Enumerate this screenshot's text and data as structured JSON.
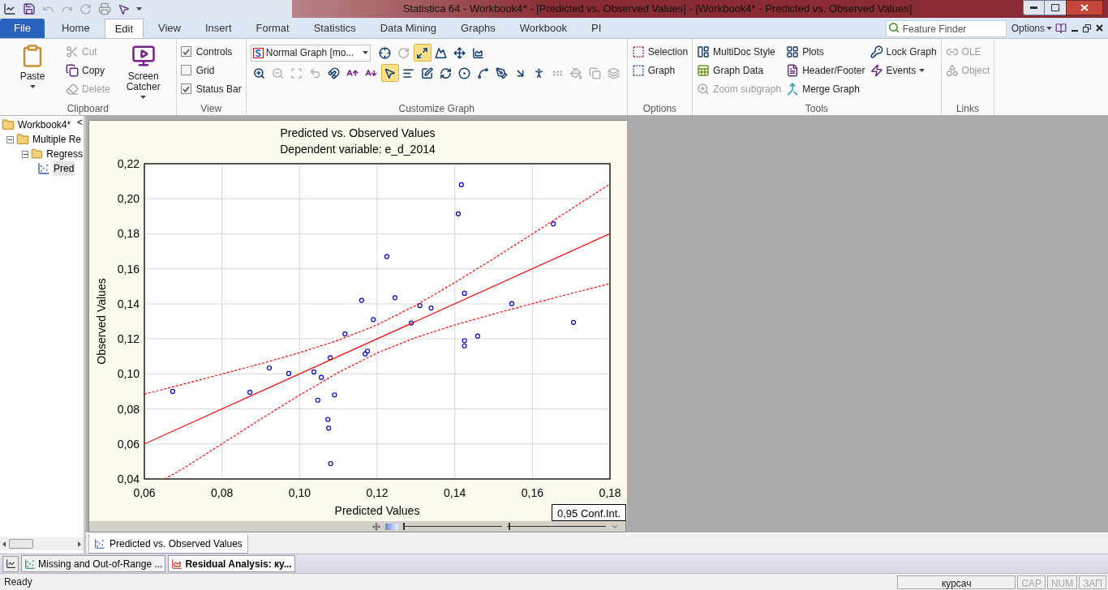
{
  "window": {
    "title": "Statistica 64 - Workbook4* - [Predicted vs. Observed Values] - [Workbook4* - Predicted vs. Observed Values]"
  },
  "ribbon_tabs": [
    {
      "label": "File",
      "kind": "file",
      "selected": false
    },
    {
      "label": "Home",
      "kind": "tab",
      "selected": false
    },
    {
      "label": "Edit",
      "kind": "tab",
      "selected": true
    },
    {
      "label": "View",
      "kind": "tab",
      "selected": false
    },
    {
      "label": "Insert",
      "kind": "tab",
      "selected": false
    },
    {
      "label": "Format",
      "kind": "tab",
      "selected": false
    },
    {
      "label": "Statistics",
      "kind": "tab",
      "selected": false
    },
    {
      "label": "Data Mining",
      "kind": "tab",
      "selected": false
    },
    {
      "label": "Graphs",
      "kind": "tab",
      "selected": false
    },
    {
      "label": "Workbook",
      "kind": "tab",
      "selected": false
    },
    {
      "label": "PI",
      "kind": "tab",
      "selected": false
    }
  ],
  "feature_finder": {
    "placeholder": "Feature Finder"
  },
  "options_menu": {
    "label": "Options"
  },
  "ribbon_groups": [
    {
      "label": "Clipboard",
      "columns": [
        [
          {
            "kind": "large",
            "label": "Paste",
            "disabled": false,
            "dropdown": true
          }
        ],
        [
          {
            "kind": "small",
            "label": "Cut",
            "disabled": true
          },
          {
            "kind": "small",
            "label": "Copy",
            "disabled": false
          },
          {
            "kind": "small",
            "label": "Delete",
            "disabled": true
          }
        ],
        [
          {
            "kind": "large",
            "label": "Screen Catcher",
            "disabled": false,
            "dropdown": true
          }
        ]
      ]
    },
    {
      "label": "View",
      "columns": [
        [
          {
            "kind": "check",
            "label": "Controls",
            "checked": true
          },
          {
            "kind": "check",
            "label": "Grid",
            "checked": false
          },
          {
            "kind": "check",
            "label": "Status Bar",
            "checked": true
          }
        ]
      ]
    },
    {
      "label": "Customize Graph",
      "combo": {
        "value": "Normal Graph [mo..."
      },
      "tool_rows": [
        [
          {
            "selected": false,
            "disabled": false
          },
          {
            "selected": false,
            "disabled": true
          },
          {
            "selected": true,
            "disabled": false
          },
          {
            "selected": false,
            "disabled": false
          },
          {
            "selected": false,
            "disabled": false
          },
          {
            "selected": false,
            "disabled": false
          }
        ],
        [
          {
            "selected": false,
            "disabled": false
          },
          {
            "selected": false,
            "disabled": true
          },
          {
            "selected": false,
            "disabled": true
          },
          {
            "selected": false,
            "disabled": true
          },
          {
            "selected": false,
            "disabled": false
          },
          {
            "selected": false,
            "disabled": false
          },
          {
            "selected": false,
            "disabled": false
          },
          {
            "selected": true,
            "disabled": false
          },
          {
            "selected": false,
            "disabled": false
          },
          {
            "selected": false,
            "disabled": false
          },
          {
            "selected": false,
            "disabled": false
          },
          {
            "selected": false,
            "disabled": false
          },
          {
            "selected": false,
            "disabled": false
          },
          {
            "selected": false,
            "disabled": false
          },
          {
            "selected": false,
            "disabled": false
          },
          {
            "selected": false,
            "disabled": false
          },
          {
            "selected": false,
            "disabled": true
          },
          {
            "selected": false,
            "disabled": true
          },
          {
            "selected": false,
            "disabled": true
          },
          {
            "selected": false,
            "disabled": true
          }
        ]
      ]
    },
    {
      "label": "Options",
      "columns": [
        [
          {
            "kind": "small",
            "label": "Selection",
            "disabled": false
          },
          {
            "kind": "small",
            "label": "Graph",
            "disabled": false
          }
        ]
      ]
    },
    {
      "label": "Tools",
      "columns": [
        [
          {
            "kind": "small",
            "label": "MultiDoc Style",
            "disabled": false
          },
          {
            "kind": "small",
            "label": "Graph Data",
            "disabled": false
          },
          {
            "kind": "small",
            "label": "Zoom subgraph",
            "disabled": true
          }
        ],
        [
          {
            "kind": "small",
            "label": "Plots",
            "disabled": false
          },
          {
            "kind": "small",
            "label": "Header/Footer",
            "disabled": false
          },
          {
            "kind": "small",
            "label": "Merge Graph",
            "disabled": false
          }
        ],
        [
          {
            "kind": "small",
            "label": "Lock Graph",
            "disabled": false
          },
          {
            "kind": "small",
            "label": "Events",
            "disabled": false,
            "dropdown": true
          }
        ]
      ]
    },
    {
      "label": "Links",
      "columns": [
        [
          {
            "kind": "small",
            "label": "OLE",
            "disabled": true
          },
          {
            "kind": "small",
            "label": "Object",
            "disabled": true
          }
        ]
      ]
    }
  ],
  "tree": {
    "collapse_button": "<",
    "root": {
      "label": "Workbook4*",
      "selected": false,
      "children": [
        {
          "label": "Multiple Re",
          "expanded": true,
          "selected": false,
          "children": [
            {
              "label": "Regress",
              "expanded": true,
              "selected": false,
              "children": [
                {
                  "label": "Pred",
                  "selected": true
                }
              ]
            }
          ]
        }
      ]
    }
  },
  "graph": {
    "title": "Predicted vs. Observed Values",
    "subtitle": "Dependent variable: e_d_2014",
    "legend": "0,95 Conf.Int.",
    "chart_data": {
      "type": "scatter",
      "xlabel": "Predicted Values",
      "ylabel": "Observed Values",
      "grid": true,
      "xlim": [
        0.06,
        0.18
      ],
      "ylim": [
        0.04,
        0.22
      ],
      "xticks": [
        {
          "value": 0.06,
          "label": "0,06"
        },
        {
          "value": 0.08,
          "label": "0,08"
        },
        {
          "value": 0.1,
          "label": "0,10"
        },
        {
          "value": 0.12,
          "label": "0,12"
        },
        {
          "value": 0.14,
          "label": "0,14"
        },
        {
          "value": 0.16,
          "label": "0,16"
        },
        {
          "value": 0.18,
          "label": "0,18"
        }
      ],
      "yticks": [
        {
          "value": 0.04,
          "label": "0,04"
        },
        {
          "value": 0.06,
          "label": "0,06"
        },
        {
          "value": 0.08,
          "label": "0,08"
        },
        {
          "value": 0.1,
          "label": "0,10"
        },
        {
          "value": 0.12,
          "label": "0,12"
        },
        {
          "value": 0.14,
          "label": "0,14"
        },
        {
          "value": 0.16,
          "label": "0,16"
        },
        {
          "value": 0.18,
          "label": "0,18"
        },
        {
          "value": 0.2,
          "label": "0,20"
        },
        {
          "value": 0.22,
          "label": "0,22"
        }
      ],
      "series": [
        {
          "type": "scatter",
          "color": "#0000cc",
          "x": [
            0.0673,
            0.0872,
            0.0922,
            0.0972,
            0.1037,
            0.1047,
            0.1056,
            0.1073,
            0.1075,
            0.1079,
            0.109,
            0.108,
            0.1117,
            0.116,
            0.1169,
            0.1175,
            0.119,
            0.1225,
            0.1246,
            0.1288,
            0.131,
            0.1339,
            0.1409,
            0.1417,
            0.1425,
            0.1425,
            0.1425,
            0.1459,
            0.1547,
            0.1654,
            0.1706
          ],
          "values": [
            0.09,
            0.0895,
            0.1034,
            0.1002,
            0.1011,
            0.085,
            0.098,
            0.074,
            0.069,
            0.1092,
            0.088,
            0.0488,
            0.1228,
            0.142,
            0.1114,
            0.113,
            0.131,
            0.167,
            0.1435,
            0.129,
            0.139,
            0.1376,
            0.1914,
            0.208,
            0.146,
            0.119,
            0.116,
            0.1216,
            0.1401,
            0.1856,
            0.1294
          ]
        },
        {
          "type": "line",
          "color": "#ff0000",
          "x": [
            0.06,
            0.18
          ],
          "values": [
            0.06,
            0.18
          ]
        },
        {
          "type": "line",
          "line_style": "dashed",
          "color": "#ff0000",
          "x": [
            0.06,
            0.07,
            0.08,
            0.09,
            0.1,
            0.11,
            0.12,
            0.13,
            0.14,
            0.15,
            0.16,
            0.17,
            0.18
          ],
          "values": [
            0.0885,
            0.0941,
            0.0999,
            0.1058,
            0.1121,
            0.1192,
            0.128,
            0.1392,
            0.1521,
            0.1658,
            0.1799,
            0.1941,
            0.2085
          ]
        },
        {
          "type": "line",
          "line_style": "dashed",
          "color": "#ff0000",
          "x": [
            0.0652,
            0.07,
            0.08,
            0.09,
            0.1,
            0.11,
            0.12,
            0.13,
            0.14,
            0.15,
            0.16,
            0.17,
            0.18
          ],
          "values": [
            0.04,
            0.0459,
            0.0601,
            0.0742,
            0.0879,
            0.1008,
            0.112,
            0.1208,
            0.1279,
            0.1342,
            0.1401,
            0.1459,
            0.1515
          ]
        }
      ]
    },
    "zoom_sliders": [
      {
        "level": 0
      },
      {
        "level": 0.02
      }
    ]
  },
  "doc_tabs": [
    {
      "label": "Predicted vs. Observed Values",
      "selected": true
    }
  ],
  "taskbar": [
    {
      "label": "Missing and Out-of-Range ...",
      "active": false
    },
    {
      "label": "Residual Analysis: ку...",
      "active": true
    }
  ],
  "status_bar": {
    "text": "Ready",
    "panes": [
      {
        "label": "курсач",
        "disabled": false
      },
      {
        "label": "CAP",
        "disabled": true
      },
      {
        "label": "NUM",
        "disabled": true
      },
      {
        "label": "ЗАП",
        "disabled": true
      }
    ]
  }
}
